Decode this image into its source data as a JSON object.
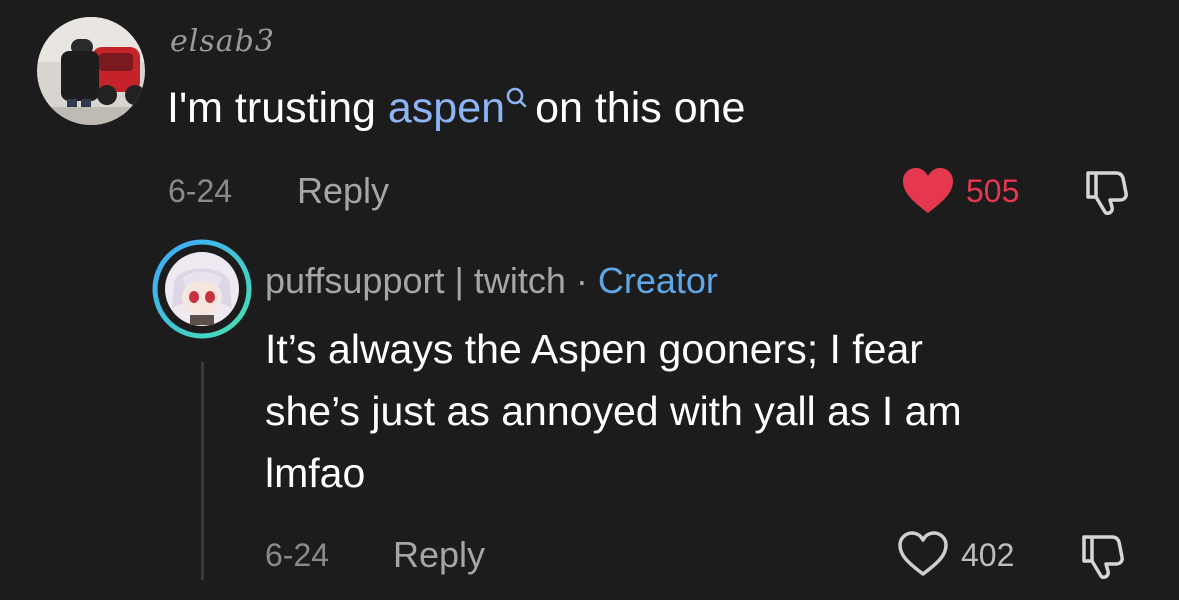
{
  "comment": {
    "username": "elsab3",
    "text_before": "I'm trusting ",
    "mention": "aspen",
    "text_after": "on this one",
    "date": "6-24",
    "reply_label": "Reply",
    "likes": "505",
    "liked": true,
    "colors": {
      "like_active": "#e5374e",
      "mention": "#8db4f5"
    }
  },
  "reply": {
    "username": "puffsupport | twitch",
    "separator": " · ",
    "badge": "Creator",
    "text_lines": [
      "It’s always the Aspen gooners; I fear",
      "she’s just as annoyed with yall as I am",
      "lmfao"
    ],
    "date": "6-24",
    "reply_label": "Reply",
    "likes": "402",
    "liked": false,
    "colors": {
      "creator": "#5fa8e8"
    }
  },
  "icons": {
    "like": "heart-icon",
    "dislike": "thumbs-down-icon",
    "mention_search": "search-icon"
  }
}
